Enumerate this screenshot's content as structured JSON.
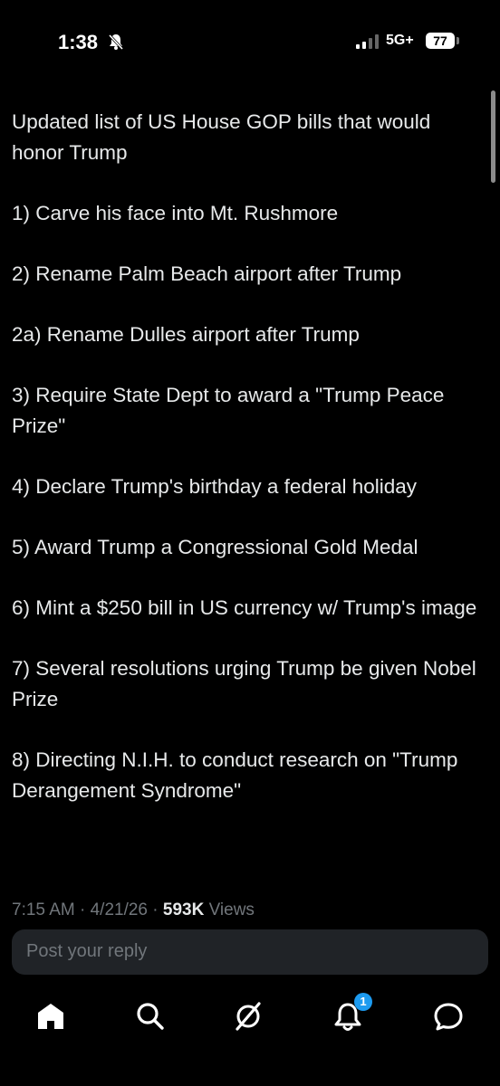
{
  "status_bar": {
    "time": "1:38",
    "network": "5G+",
    "battery": "77"
  },
  "tweet": {
    "paragraphs": [
      "Updated list of US House GOP bills that would honor Trump",
      "1)  Carve his face into Mt. Rushmore",
      "2) Rename Palm Beach airport after Trump",
      "2a) Rename Dulles airport after Trump",
      "3) Require State Dept to award a \"Trump Peace Prize\"",
      "4) Declare Trump's birthday a federal holiday",
      "5) Award Trump a Congressional Gold Medal",
      "6) Mint a $250 bill in US currency w/ Trump's image",
      "7) Several resolutions urging Trump be given Nobel\nPrize",
      "8) Directing N.I.H. to conduct research on \"Trump Derangement Syndrome\""
    ],
    "timestamp": "7:15 AM · 4/21/26 · ",
    "views_count": "593K",
    "views_label": " Views"
  },
  "reply": {
    "placeholder": "Post your reply"
  },
  "nav": {
    "notification_count": "1",
    "items": [
      "home-icon",
      "search-icon",
      "grok-icon",
      "notifications-icon",
      "messages-icon"
    ]
  }
}
